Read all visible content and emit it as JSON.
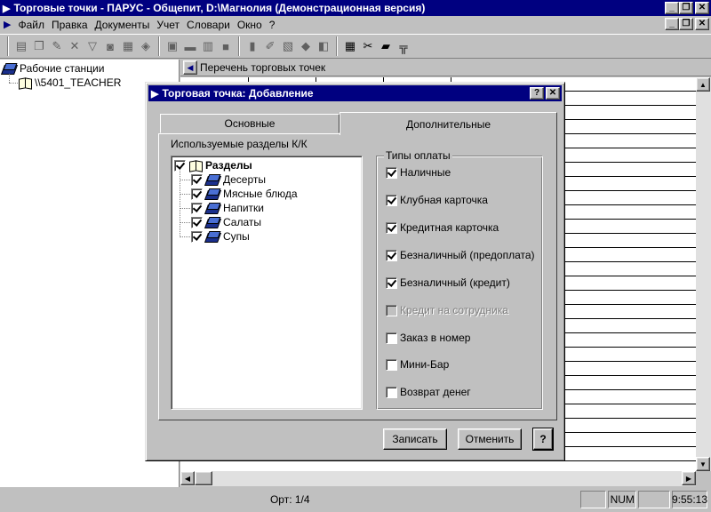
{
  "window": {
    "title": "Торговые точки - ПАРУС - Общепит, D:\\Магнолия (Демонстрационная версия)",
    "controls": {
      "minimize": "_",
      "restore": "❐",
      "close": "✕"
    }
  },
  "menu": {
    "items": [
      {
        "label": "Файл",
        "accel": "Ф"
      },
      {
        "label": "Правка",
        "accel": "П"
      },
      {
        "label": "Документы",
        "accel": "Д"
      },
      {
        "label": "Учет",
        "accel": "У"
      },
      {
        "label": "Словари",
        "accel": "С"
      },
      {
        "label": "Окно",
        "accel": "О"
      },
      {
        "label": "?",
        "accel": "?"
      }
    ]
  },
  "toolbar": {
    "icons": [
      "new-doc-icon",
      "copy-doc-icon",
      "edit-doc-icon",
      "delete-icon",
      "filter-icon",
      "print-preview-icon",
      "print-icon",
      "package-icon",
      "workstation-icon",
      "card-icon",
      "table-icon",
      "block-icon",
      "notebook-icon",
      "tools-edit-icon",
      "clipboard-icon",
      "group-icon",
      "bookmark-icon",
      "calculator-icon",
      "wrench-icon",
      "folder-icon",
      "tree-folder-icon"
    ]
  },
  "tree": {
    "root": "Рабочие станции",
    "child": "\\\\5401_TEACHER"
  },
  "list": {
    "header": "Перечень торговых точек"
  },
  "status": {
    "record": "Орт: 1/4",
    "num": "NUM",
    "time": "9:55:13"
  },
  "dialog": {
    "title": "Торговая точка: Добавление",
    "help_btn": "?",
    "close_btn": "✕",
    "tabs": [
      {
        "label": "Основные",
        "active": false
      },
      {
        "label": "Дополнительные",
        "active": true
      }
    ],
    "sections_label": "Используемые разделы К/К",
    "sections": {
      "root": "Разделы",
      "items": [
        "Десерты",
        "Мясные блюда",
        "Напитки",
        "Салаты",
        "Супы"
      ]
    },
    "payment_group": {
      "title": "Типы оплаты",
      "items": [
        {
          "label": "Наличные",
          "checked": true,
          "enabled": true
        },
        {
          "label": "Клубная карточка",
          "checked": true,
          "enabled": true
        },
        {
          "label": "Кредитная карточка",
          "checked": true,
          "enabled": true
        },
        {
          "label": "Безналичный (предоплата)",
          "checked": true,
          "enabled": true
        },
        {
          "label": "Безналичный (кредит)",
          "checked": true,
          "enabled": true
        },
        {
          "label": "Кредит на сотрудника",
          "checked": false,
          "enabled": false
        },
        {
          "label": "Заказ в номер",
          "checked": false,
          "enabled": true
        },
        {
          "label": "Мини-Бар",
          "checked": false,
          "enabled": true
        },
        {
          "label": "Возврат денег",
          "checked": false,
          "enabled": true
        }
      ]
    },
    "buttons": {
      "save": "Записать",
      "cancel": "Отменить",
      "help": "?"
    }
  }
}
